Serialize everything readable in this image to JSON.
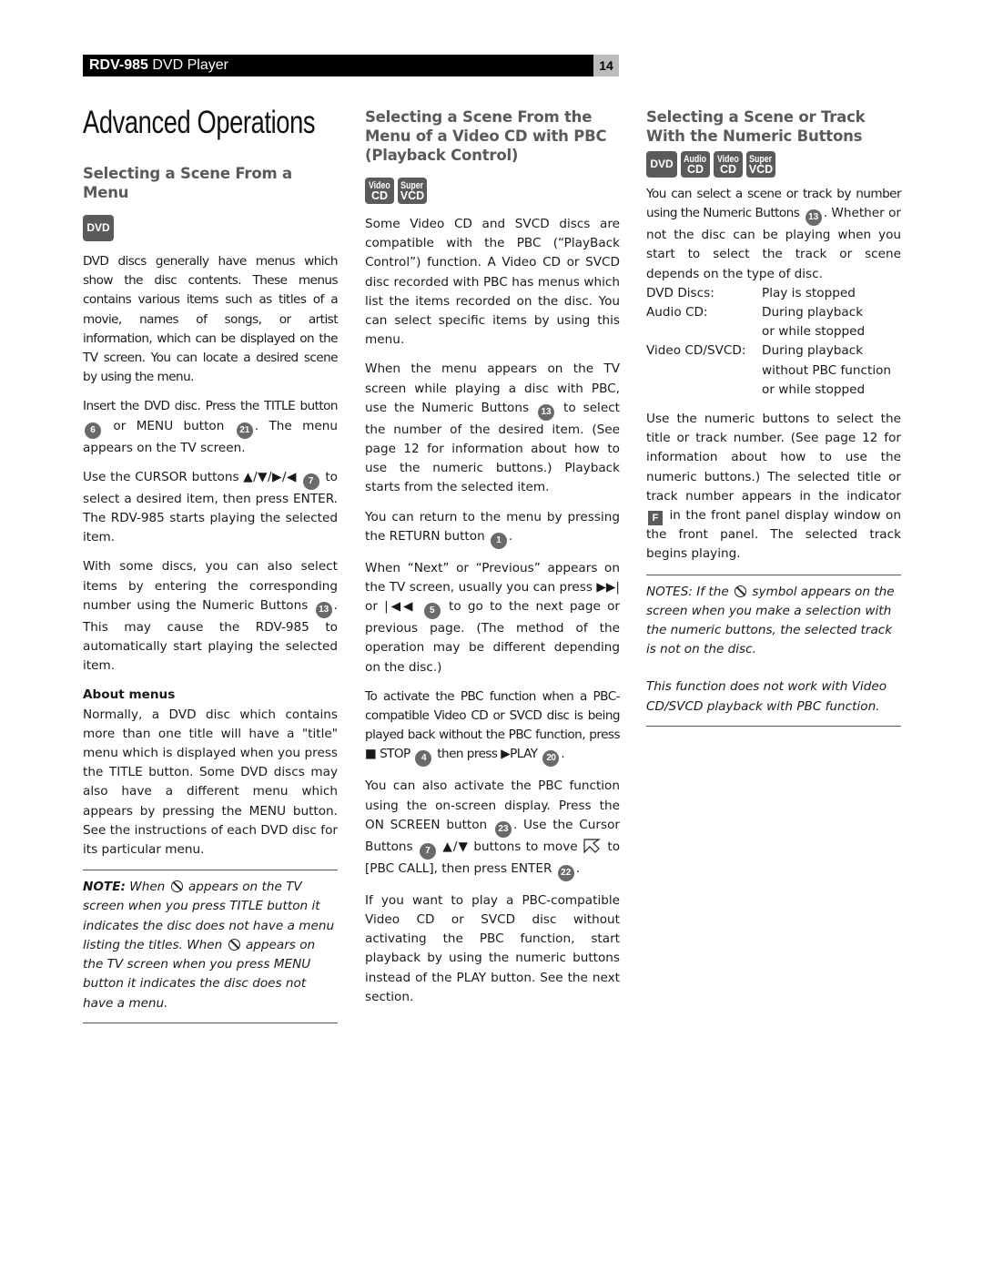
{
  "header": {
    "model": "RDV-985",
    "product": "DVD Player",
    "page_number": "14"
  },
  "page_title": "Advanced Operations",
  "col1": {
    "heading": "Selecting a Scene From a Menu",
    "badges": [
      "DVD"
    ],
    "p1": "DVD discs generally have menus which show the disc contents. These menus contains various items such as titles of a movie, names of songs, or artist information, which can be displayed on the TV screen. You can locate a desired scene by using the menu.",
    "p2a": "Insert the DVD disc. Press the TITLE button",
    "btn_title": "6",
    "p2b": "or MENU button",
    "btn_menu": "21",
    "p2c": ". The menu appears on the TV screen.",
    "p3a": "Use the CURSOR buttons ▲/▼/▶/◀",
    "btn_cursor": "7",
    "p3b": "to select a desired item, then press ENTER. The RDV-985 starts playing the selected item.",
    "p4a": "With some discs, you can also select items by entering the corresponding number using the Numeric Buttons",
    "btn_numeric": "13",
    "p4b": ". This may cause the RDV-985 to automatically start playing the selected item.",
    "about_heading": "About menus",
    "about_text": "Normally, a DVD disc which contains more than one title will have a \"title\" menu which is displayed when you press the TITLE button. Some DVD discs may also have a different menu which appears by pressing the MENU button. See the instructions of each DVD disc for its particular menu.",
    "note_label": "NOTE:",
    "note_a": "When",
    "note_b": "appears on the TV screen when you press TITLE button it indicates the disc does not have a menu listing the titles. When",
    "note_c": "appears on the TV screen when you press MENU button it indicates the disc does not have a menu."
  },
  "col2": {
    "heading": "Selecting a Scene From the Menu of a Video CD with PBC (Playback Control)",
    "badges": [
      {
        "top": "Video",
        "bottom": "CD"
      },
      {
        "top": "Super",
        "bottom": "VCD"
      }
    ],
    "p1": "Some Video CD and SVCD discs are compatible with the PBC (“PlayBack Control”) function.  A Video CD or SVCD disc recorded with PBC has menus which list the items recorded on the disc. You can select specific items by using this menu.",
    "p2a": "When the menu appears on the TV screen while playing a disc with PBC, use the Numeric Buttons",
    "btn_numeric": "13",
    "p2b": "to select the number of the desired item. (See page 12 for information about how to use the numeric buttons.) Playback starts from the selected item.",
    "p3a": "You can return to the menu by pressing the RETURN button",
    "btn_return": "1",
    "p3b": ".",
    "p4a": "When “Next” or “Previous” appears on the TV screen, usually you can press ▶▶| or |◀◀",
    "btn_skip": "5",
    "p4b": "to go to the next page or previous page. (The method of the operation may be different depending on the disc.)",
    "p5a": "To activate the PBC function when a PBC-compatible Video CD or SVCD disc is being played back without the PBC function, press ■ STOP",
    "btn_stop": "4",
    "p5b": "then press ▶PLAY",
    "btn_play": "20",
    "p5c": ".",
    "p6a": "You can also activate the PBC function using the on-screen display. Press the ON SCREEN button",
    "btn_onscreen": "23",
    "p6b": ". Use the Cursor Buttons",
    "btn_cursor": "7",
    "p6c": "▲/▼ buttons to move",
    "p6d": "to [PBC CALL], then press ENTER",
    "btn_enter": "22",
    "p6e": ".",
    "p7": "If you want to play a PBC-compatible Video CD or SVCD disc without activating the PBC function, start playback by using the numeric buttons instead of the PLAY button. See the next section."
  },
  "col3": {
    "heading": "Selecting a Scene or Track With the Numeric Buttons",
    "badges": [
      {
        "single": "DVD"
      },
      {
        "top": "Audio",
        "bottom": "CD"
      },
      {
        "top": "Video",
        "bottom": "CD"
      },
      {
        "top": "Super",
        "bottom": "VCD"
      }
    ],
    "p1a": "You can select a scene or track by number using the Numeric Buttons",
    "btn_numeric": "13",
    "p1b": ". Whether or not the disc can be playing when you start to select the track or scene depends on the type of disc.",
    "table": [
      {
        "disc": "DVD Discs:",
        "lines": [
          "Play is stopped"
        ]
      },
      {
        "disc": "Audio CD:",
        "lines": [
          "During playback",
          "or while stopped"
        ]
      },
      {
        "disc": "Video CD/SVCD:",
        "lines": [
          "During playback",
          "without PBC function",
          "or while stopped"
        ]
      }
    ],
    "p2a": "Use the numeric buttons to select the title or track number. (See page 12 for information about how to use the numeric buttons.) The selected title or track number appears in the indicator",
    "indicator": "F",
    "p2b": "in the front panel display window on the front panel. The selected track begins playing.",
    "note1a": "NOTES: If the",
    "note1b": "symbol appears on the screen when you make a selection with the numeric buttons, the selected track is not on the disc.",
    "note2": "This function does not work with Video CD/SVCD playback with PBC function."
  }
}
